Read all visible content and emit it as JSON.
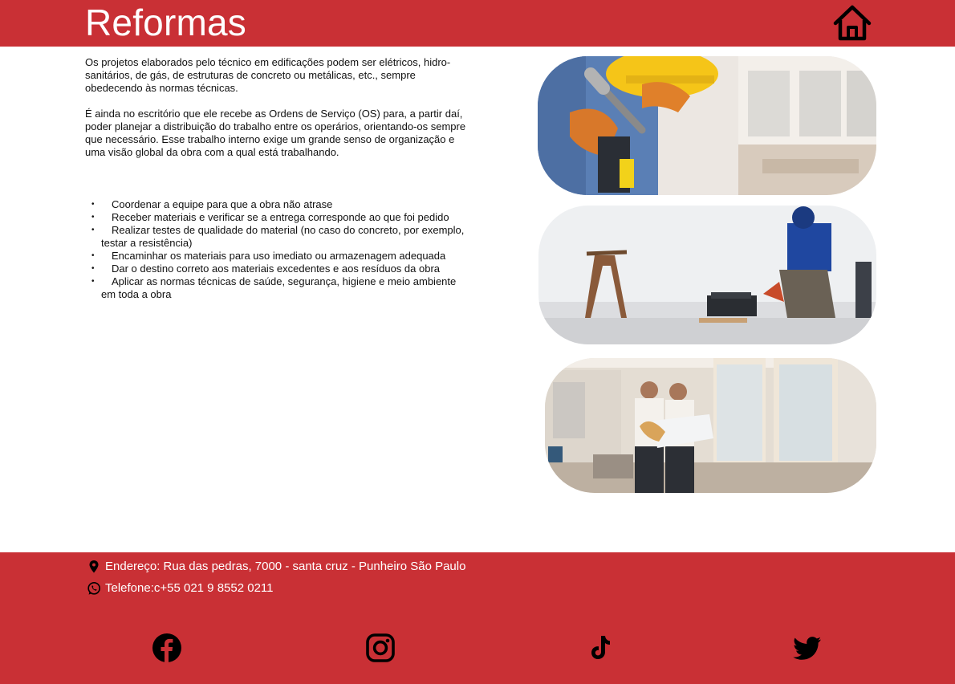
{
  "header": {
    "title": "Reformas",
    "home_icon": "home-icon",
    "colors": {
      "bar": "#c93035",
      "title": "#ffffff"
    }
  },
  "intro": {
    "paragraphs": [
      "Os projetos elaborados pelo técnico em edificações podem ser elétricos, hidro-sanitários, de gás, de estruturas de concreto ou metálicas, etc., sempre obedecendo às normas técnicas.",
      "É ainda no escritório que ele recebe as Ordens de Serviço (OS) para, a partir daí, poder planejar a distribuição do trabalho entre os operários, orientando-os sempre que necessário. Esse trabalho interno exige um grande senso de organização e uma visão global da obra com a qual está trabalhando."
    ]
  },
  "tasks": [
    "Coordenar a equipe para que a obra não atrase",
    "Receber materiais e verificar se a entrega corresponde ao que foi pedido",
    "Realizar testes de qualidade do material (no caso do concreto, por exemplo, testar a resistência)",
    "Encaminhar os materiais para uso imediato ou armazenagem adequada",
    "Dar o destino correto aos materiais excedentes e aos resíduos da obra",
    "Aplicar as normas técnicas de saúde, segurança, higiene e meio ambiente em toda a obra"
  ],
  "footer": {
    "address": "Endereço: Rua das pedras, 7000 - santa cruz - Punheiro São Paulo",
    "phone": "Telefone:c+55 021 9 8552 0211",
    "icons": {
      "address": "location-pin-icon",
      "phone": "whatsapp-icon",
      "social": [
        "facebook-icon",
        "instagram-icon",
        "tiktok-icon",
        "twitter-icon"
      ]
    }
  }
}
